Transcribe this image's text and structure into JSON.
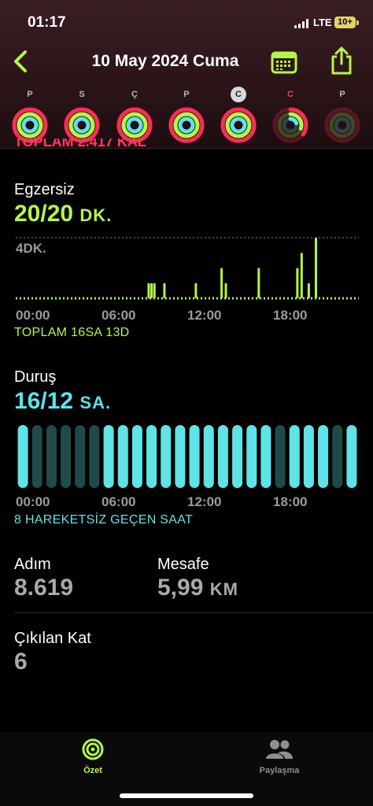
{
  "status": {
    "time": "01:17",
    "network": "LTE",
    "battery": "10+"
  },
  "nav": {
    "title": "10 May 2024 Cuma"
  },
  "week": [
    {
      "letter": "P",
      "move": 1.0,
      "exercise": 1.0,
      "stand": 1.0,
      "state": "normal"
    },
    {
      "letter": "S",
      "move": 1.0,
      "exercise": 1.0,
      "stand": 1.0,
      "state": "normal"
    },
    {
      "letter": "Ç",
      "move": 1.0,
      "exercise": 1.0,
      "stand": 1.0,
      "state": "normal"
    },
    {
      "letter": "P",
      "move": 1.0,
      "exercise": 1.0,
      "stand": 1.0,
      "state": "normal"
    },
    {
      "letter": "C",
      "move": 1.0,
      "exercise": 1.0,
      "stand": 1.0,
      "state": "selected"
    },
    {
      "letter": "C",
      "move": 0.35,
      "exercise": 0.3,
      "stand": 0.2,
      "state": "today"
    },
    {
      "letter": "P",
      "move": 0.0,
      "exercise": 0.0,
      "stand": 0.0,
      "state": "normal"
    }
  ],
  "move_total_clipped": "TOPLAM 2.417 KAL",
  "exercise": {
    "label": "Egzersiz",
    "value": "20/20",
    "unit": "DK.",
    "max_label": "4DK.",
    "total": "TOPLAM 16SA 13D"
  },
  "stand": {
    "label": "Duruş",
    "value": "16/12",
    "unit": "SA.",
    "summary": "8 HAREKETSİZ GEÇEN SAAT"
  },
  "time_axis": [
    "00:00",
    "06:00",
    "12:00",
    "18:00"
  ],
  "steps": {
    "label": "Adım",
    "value": "8.619"
  },
  "distance": {
    "label": "Mesafe",
    "value": "5,99",
    "unit": "KM"
  },
  "floors": {
    "label": "Çıkılan Kat",
    "value": "6"
  },
  "tabs": {
    "summary": "Özet",
    "sharing": "Paylaşma"
  },
  "colors": {
    "move": "#ff2d55",
    "exercise": "#b3f64a",
    "stand": "#5fe3e6",
    "stand_inactive": "#1f4a48"
  },
  "chart_data": [
    {
      "type": "bar",
      "title": "Egzersiz",
      "ylabel": "DK.",
      "x_unit": "hour",
      "x": [
        9.3,
        9.5,
        9.7,
        10.4,
        12.6,
        14.4,
        14.7,
        17.0,
        19.7,
        20.0,
        20.5,
        21.0
      ],
      "values": [
        1.0,
        1.0,
        1.0,
        1.0,
        1.0,
        2.0,
        1.0,
        2.0,
        2.0,
        3.0,
        1.0,
        4.0
      ],
      "ylim": [
        0,
        4
      ],
      "xlim": [
        0,
        24
      ]
    },
    {
      "type": "bar",
      "title": "Duruş",
      "categories": [
        "00",
        "01",
        "02",
        "03",
        "04",
        "05",
        "06",
        "07",
        "08",
        "09",
        "10",
        "11",
        "12",
        "13",
        "14",
        "15",
        "16",
        "17",
        "18",
        "19",
        "20",
        "21",
        "22",
        "23"
      ],
      "values": [
        1,
        0,
        0,
        0,
        0,
        0,
        1,
        1,
        1,
        1,
        1,
        1,
        1,
        1,
        1,
        1,
        1,
        1,
        0,
        1,
        1,
        1,
        0,
        1
      ]
    }
  ]
}
